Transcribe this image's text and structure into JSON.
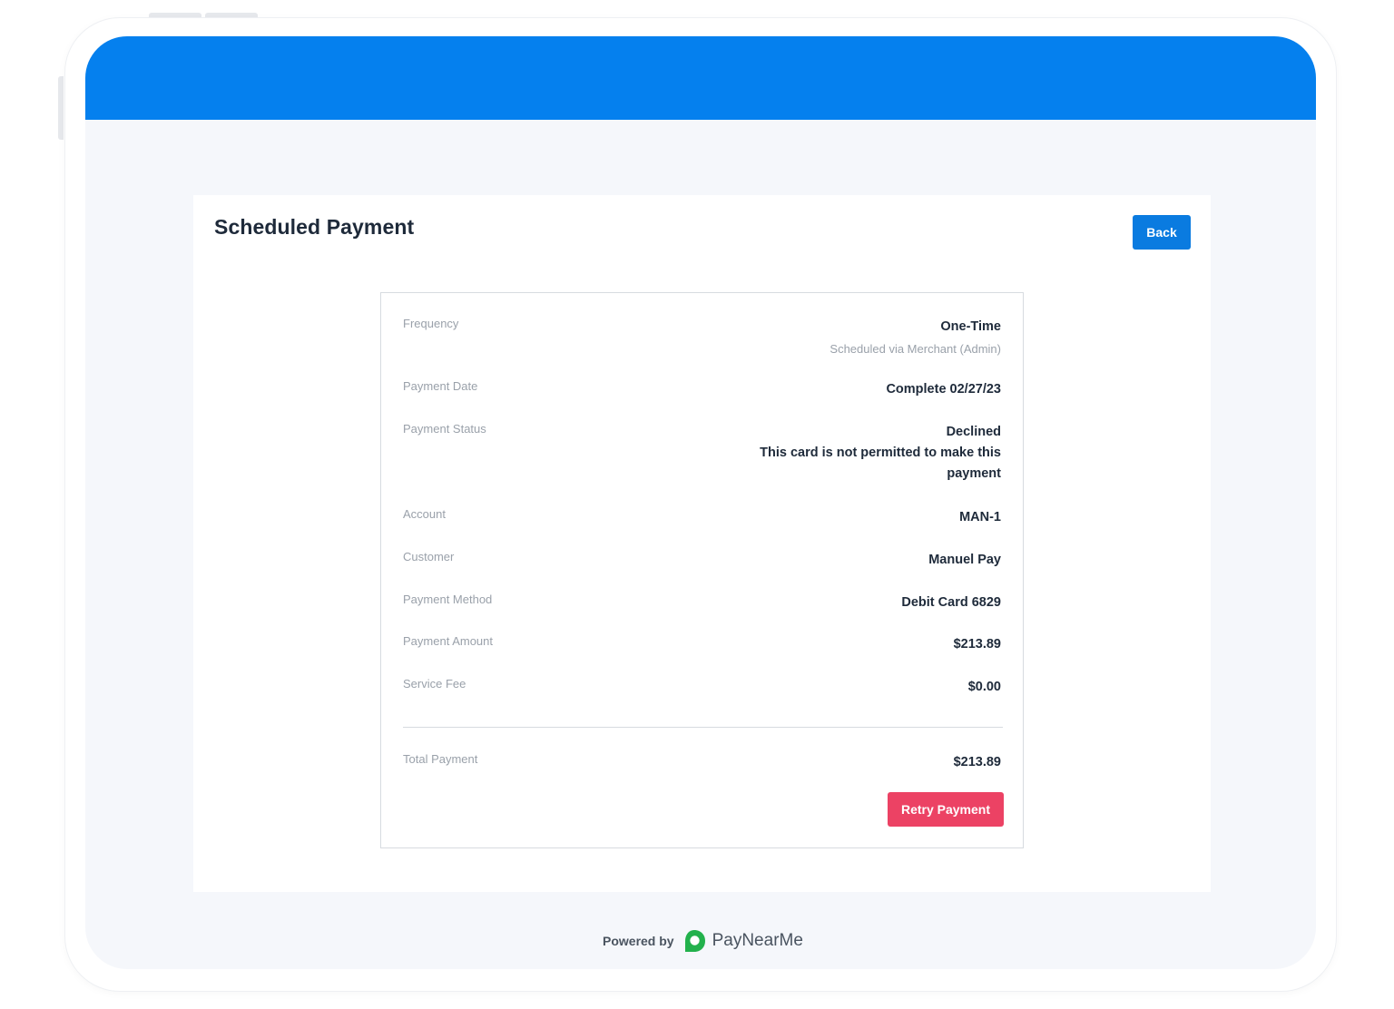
{
  "page": {
    "title": "Scheduled Payment",
    "back_label": "Back"
  },
  "details": {
    "rows": [
      {
        "label": "Frequency",
        "value": "One-Time",
        "sub": "Scheduled via Merchant (Admin)"
      },
      {
        "label": "Payment Date",
        "value": "Complete 02/27/23"
      },
      {
        "label": "Payment Status",
        "value": "Declined",
        "sub": "This card is not permitted to make this payment"
      },
      {
        "label": "Account",
        "value": "MAN-1"
      },
      {
        "label": "Customer",
        "value": "Manuel Pay"
      },
      {
        "label": "Payment Method",
        "value": "Debit Card 6829"
      },
      {
        "label": "Payment Amount",
        "value": "$213.89"
      },
      {
        "label": "Service Fee",
        "value": "$0.00"
      }
    ],
    "total": {
      "label": "Total Payment",
      "value": "$213.89"
    },
    "retry_label": "Retry Payment"
  },
  "footer": {
    "powered_by": "Powered by",
    "brand": "PayNearMe",
    "logo_icon": "paynearme-logo-icon"
  },
  "colors": {
    "header_blue": "#0580ee",
    "primary_button": "#0a7be0",
    "danger_button": "#ec4264",
    "brand_green": "#22b14c"
  }
}
